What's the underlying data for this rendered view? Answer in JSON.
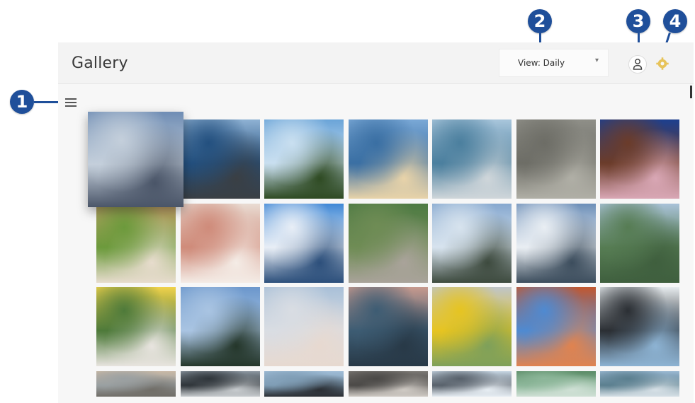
{
  "app": {
    "title": "Gallery",
    "view_select": {
      "label": "View: Daily",
      "caret": "▾"
    },
    "profile_icon": "person-icon",
    "settings_icon": "gear-icon",
    "menu_icon": "menu-icon"
  },
  "callouts": [
    {
      "number": "1",
      "target": "menu-button"
    },
    {
      "number": "2",
      "target": "view-select"
    },
    {
      "number": "3",
      "target": "profile-button"
    },
    {
      "number": "4",
      "target": "settings-button"
    }
  ],
  "photos": [
    {
      "scene": "clouds",
      "colors": [
        "#6f8db4",
        "#c4cfdb",
        "#4a5568"
      ],
      "focused": true
    },
    {
      "scene": "sea",
      "colors": [
        "#8fb2d4",
        "#23507f",
        "#3a3f44"
      ]
    },
    {
      "scene": "palms",
      "colors": [
        "#6aa4d8",
        "#c9dff0",
        "#2e4a22"
      ]
    },
    {
      "scene": "beach",
      "colors": [
        "#7aa8d6",
        "#3a6fa3",
        "#e8d3a9"
      ]
    },
    {
      "scene": "pier",
      "colors": [
        "#a9c6dc",
        "#4b7f9e",
        "#cfd6da"
      ]
    },
    {
      "scene": "gravel",
      "colors": [
        "#8f8f88",
        "#6d6d66",
        "#b0afa6"
      ]
    },
    {
      "scene": "macarons",
      "colors": [
        "#1c3f8f",
        "#6b3c2a",
        "#d9a7b5"
      ]
    },
    {
      "scene": "plant",
      "colors": [
        "#c9a36d",
        "#6c9a3c",
        "#e7dccd"
      ]
    },
    {
      "scene": "drink",
      "colors": [
        "#e9dcd3",
        "#cf8b7a",
        "#f4ece6"
      ]
    },
    {
      "scene": "umbrella",
      "colors": [
        "#3f88d6",
        "#e8eef6",
        "#2c4f7b"
      ]
    },
    {
      "scene": "forest",
      "colors": [
        "#4d7a43",
        "#6f8c55",
        "#a9a39a"
      ]
    },
    {
      "scene": "tower",
      "colors": [
        "#86a8cf",
        "#d7e3ee",
        "#3d4a3e"
      ]
    },
    {
      "scene": "mountains",
      "colors": [
        "#6d8fb8",
        "#e9eef3",
        "#3c4d5d"
      ]
    },
    {
      "scene": "hills",
      "colors": [
        "#a9c2d8",
        "#567c53",
        "#3f5f3e"
      ]
    },
    {
      "scene": "eggs",
      "colors": [
        "#f0d24b",
        "#4e7a3a",
        "#e8e4df"
      ]
    },
    {
      "scene": "tree",
      "colors": [
        "#6b97cc",
        "#a9c4e2",
        "#24362a"
      ]
    },
    {
      "scene": "sky",
      "colors": [
        "#a9c0d8",
        "#d9dde3",
        "#e7d9d0"
      ]
    },
    {
      "scene": "sunset",
      "colors": [
        "#c79a8e",
        "#3d5c73",
        "#283947"
      ]
    },
    {
      "scene": "tulip",
      "colors": [
        "#bfc5c9",
        "#e6c421",
        "#7ea05a"
      ]
    },
    {
      "scene": "rock",
      "colors": [
        "#c2572f",
        "#4f8ad1",
        "#e0834f"
      ]
    },
    {
      "scene": "parasol",
      "colors": [
        "#e7ecef",
        "#2b2f34",
        "#8db3d3"
      ]
    },
    {
      "scene": "dusk",
      "colors": [
        "#c8b8a5",
        "#9aa0a2",
        "#706d67"
      ]
    },
    {
      "scene": "shore",
      "colors": [
        "#8c97a1",
        "#2f353a",
        "#c7cbce"
      ]
    },
    {
      "scene": "bird",
      "colors": [
        "#9fbcd6",
        "#7f9db5",
        "#2a2e33"
      ]
    },
    {
      "scene": "cliff",
      "colors": [
        "#7a7773",
        "#4b4947",
        "#cfcac4"
      ]
    },
    {
      "scene": "branches",
      "colors": [
        "#c7d6e3",
        "#58616b",
        "#e6edf3"
      ]
    },
    {
      "scene": "lake",
      "colors": [
        "#5a8b66",
        "#8db79a",
        "#cfe0d5"
      ]
    },
    {
      "scene": "valley",
      "colors": [
        "#9ab8d2",
        "#5b7f8f",
        "#d6e0e6"
      ]
    }
  ]
}
